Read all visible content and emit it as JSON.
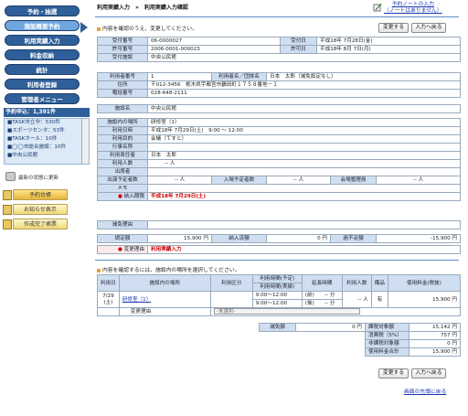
{
  "sidebar": {
    "menu": [
      "予約・抽選",
      "施設概要予約",
      "利用実績入力",
      "料金収納",
      "統計",
      "利用者登録",
      "管理者メニュー"
    ],
    "reservation_header": "予約申込：1,391件",
    "reservation_items": [
      {
        "name": "TASK市立中",
        "count": "530件"
      },
      {
        "name": "スポーツセンタ",
        "count": "53件"
      },
      {
        "name": "TASKホール",
        "count": "10件"
      },
      {
        "name": "◯◯市総合施設",
        "count": "10件"
      },
      {
        "name": "中央公民館",
        "count": ""
      }
    ],
    "reload_text": "最新の状態に更新",
    "bottom_buttons": [
      "予約台帳",
      "お知らせ表示",
      "作成完了帳票"
    ]
  },
  "header": {
    "breadcrumb": "利用実績入力　»　利用実績入力確認",
    "note_link_1": "予約ノートの入力",
    "note_link_2": "（ノートはありません）"
  },
  "intro1": "内容を確認のうえ、変更してください。",
  "intro2": "内容を確認するには、施設内の場所を選択してください。",
  "buttons": {
    "change": "変更する",
    "back": "入力へ戻る"
  },
  "permit": {
    "rows": [
      [
        "受付番号",
        "06-0000027",
        "受付日",
        "平成18年 7月28日(金)"
      ],
      [
        "許可番号",
        "2006-0001-000023",
        "許可日",
        "平成18年 8月 7日(月)"
      ]
    ],
    "facility_label": "受付施設",
    "facility": "中央公民館"
  },
  "user": {
    "id_label": "利用者番号",
    "id": "1",
    "name_label": "利用者名／団体名",
    "name": "日本　太郎（減免設定なし）",
    "addr_label": "住所",
    "addr": "〒012-3456　栃木県宇都宮市鶴田町１７５８番地－１",
    "tel_label": "電話番号",
    "tel": "028-648-2111"
  },
  "facility": {
    "label": "施設名",
    "value": "中央公民館"
  },
  "usage": {
    "place_label": "施設内の場所",
    "place": "研修室（1）",
    "date_label": "利用日時",
    "date": "平成18年 7月29日(土)　9:00 ～ 12:00",
    "purpose_label": "利用目的",
    "purpose": "会議（てすと）",
    "event_label": "行事名称",
    "event": "",
    "resp_label": "利用責任者",
    "resp": "日本　太郎",
    "count_label": "利用人数",
    "count": "-- 人",
    "attend_label": "出席者",
    "attend": "",
    "exp_in_label": "出演予定者数",
    "exp_in": "-- 人",
    "exp_ent_label": "入場予定者数",
    "exp_ent": "-- 人",
    "mgr_label": "会場整理員",
    "mgr": "-- 人",
    "memo_label": "メモ",
    "memo": "",
    "deadline_label": "納入期限",
    "deadline": "平成18年 7月29日(土)"
  },
  "fees": {
    "reduce_label": "減免理由",
    "reduce": "",
    "fixed_label": "調定額",
    "fixed": "15,900 円",
    "paid_label": "納入済額",
    "paid": "0 円",
    "short_label": "過不足額",
    "short": "-15,900 円",
    "change_label": "変更理由",
    "change": "利用実績入力"
  },
  "detail": {
    "headers": [
      "利用日",
      "施設内の場所",
      "利用区分",
      "利用時間(予定)",
      "利用時間(実績)",
      "延長時間",
      "利用人数",
      "備品",
      "使用料金(税抜)"
    ],
    "date": "7/29\n(土)",
    "place": "研修室（1）",
    "time1": "9:00～12:00",
    "time2": "9:00～12:00",
    "ext1": "(前)　　-- 分",
    "ext2": "(後)　　-- 分",
    "persons": "-- 人",
    "equip": "有",
    "fee": "15,900 円",
    "change_label": "変更理由",
    "select": "-未選択-"
  },
  "summary": {
    "reduce_label": "減免額",
    "reduce": "0 円",
    "rows": [
      [
        "課税対象額",
        "15,142 円"
      ],
      [
        "消費税（5%）",
        "757 円"
      ],
      [
        "非課税対象額",
        "0 円"
      ],
      [
        "使用料金合計",
        "15,900 円"
      ]
    ]
  },
  "footer_link": "画面の先頭に戻る"
}
